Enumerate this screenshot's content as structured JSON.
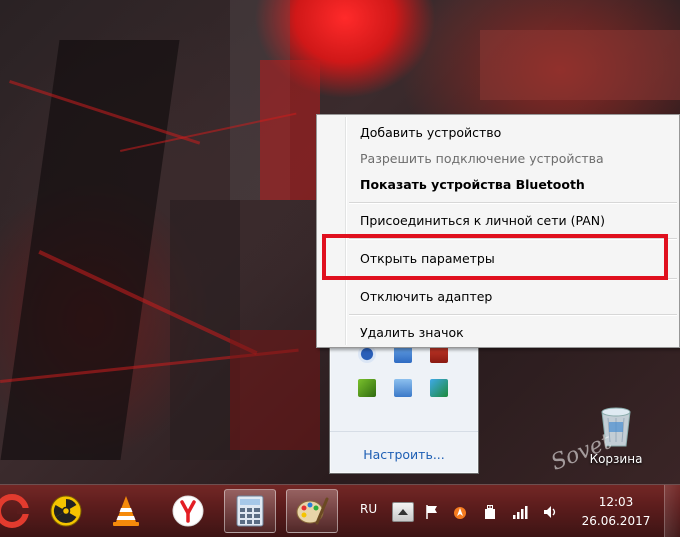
{
  "context_menu": {
    "items": [
      {
        "label": "Добавить устройство",
        "state": "normal"
      },
      {
        "label": "Разрешить подключение устройства",
        "state": "disabled"
      },
      {
        "label": "Показать устройства Bluetooth",
        "state": "bold"
      },
      {
        "label": "Присоединиться к личной сети (PAN)",
        "state": "normal"
      },
      {
        "label": "Открыть параметры",
        "state": "highlighted"
      },
      {
        "label": "Отключить адаптер",
        "state": "normal"
      },
      {
        "label": "Удалить значок",
        "state": "normal"
      }
    ],
    "highlight_color": "#e0101e"
  },
  "tray_overflow": {
    "customize_label": "Настроить...",
    "icons": [
      "bluetooth-icon",
      "network-adapter-icon",
      "app-icon",
      "nvidia-icon",
      "display-icon",
      "updater-icon"
    ]
  },
  "desktop": {
    "recycle_bin_label": "Корзина"
  },
  "taskbar": {
    "pinned": [
      "ccleaner-icon",
      "radiation-icon",
      "vlc-icon",
      "yandex-browser-icon",
      "calculator-icon",
      "paint-icon"
    ],
    "active_app": "paint-icon",
    "language": "RU",
    "system_icons": [
      "flag-icon",
      "avast-icon",
      "usb-icon",
      "signal-icon",
      "volume-icon"
    ],
    "time": "12:03",
    "date": "26.06.2017"
  },
  "watermark_text": "Sovet",
  "colors": {
    "menu_background": "#f5f5f5",
    "link": "#1e5fb4",
    "taskbar": "#5a1c1c"
  }
}
